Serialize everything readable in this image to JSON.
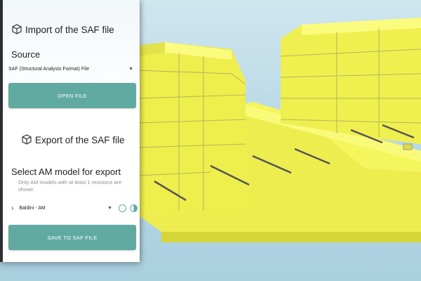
{
  "import": {
    "title": "Import of the SAF file",
    "source_label": "Source",
    "source_value": "SAF (Structural Analysis Format) File",
    "open_button": "OPEN FILE"
  },
  "export": {
    "title": "Export of the SAF file",
    "select_label": "Select AM model for export",
    "note": "Only AM models with at least 1 revisions are shown",
    "model_value": "Baldini - AM",
    "save_button": "SAVE TO SAF FILE"
  },
  "colors": {
    "accent": "#61aaa1",
    "model_yellow": "#f4f45a",
    "sky": "#bcdbe7"
  },
  "icons": {
    "import": "box-icon",
    "export": "box-icon",
    "history": "history-icon",
    "contrast": "contrast-icon",
    "chevron": "chevron-right-icon",
    "dropdown": "caret-down-icon"
  }
}
